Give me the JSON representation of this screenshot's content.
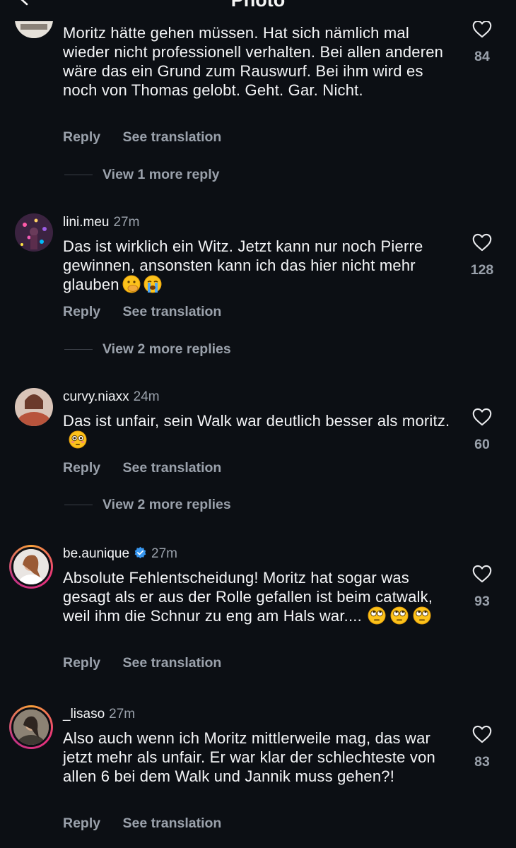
{
  "header": {
    "title": "Photo"
  },
  "comments": [
    {
      "username": "",
      "time": "",
      "text": "Moritz hätte gehen müssen. Hat sich nämlich mal wieder nicht professionell verhalten. Bei allen anderen wäre das ein Grund zum Rauswurf. Bei ihm wird es noch von Thomas gelobt. Geht. Gar. Nicht.",
      "likes": "84",
      "reply_label": "Reply",
      "translate_label": "See translation",
      "view_replies": "View 1 more reply"
    },
    {
      "username": "lini.meu",
      "time": "27m",
      "text": "Das ist wirklich ein Witz. Jetzt kann nur noch Pierre gewinnen, ansonsten kann ich das hier nicht mehr glauben",
      "emojis": [
        "face-with-hand-over-mouth-emoji",
        "loudly-crying-face-emoji"
      ],
      "likes": "128",
      "reply_label": "Reply",
      "translate_label": "See translation",
      "view_replies": "View 2 more replies"
    },
    {
      "username": "curvy.niaxx",
      "time": "24m",
      "text": "Das ist unfair, sein Walk war deutlich besser als moritz.",
      "emojis": [
        "flushed-face-emoji"
      ],
      "likes": "60",
      "reply_label": "Reply",
      "translate_label": "See translation",
      "view_replies": "View 2 more replies"
    },
    {
      "username": "be.aunique",
      "verified": true,
      "time": "27m",
      "text": "Absolute Fehlentscheidung! Moritz hat sogar was gesagt als er aus der Rolle gefallen ist beim catwalk, weil ihm die Schnur zu eng am Hals war....",
      "emojis": [
        "face-with-rolling-eyes-emoji",
        "face-with-rolling-eyes-emoji",
        "face-with-rolling-eyes-emoji"
      ],
      "likes": "93",
      "reply_label": "Reply",
      "translate_label": "See translation"
    },
    {
      "username": "_lisaso",
      "time": "27m",
      "text": "Also auch wenn ich Moritz mittlerweile mag, das war jetzt mehr als unfair. Er war klar der schlechteste von allen 6 bei dem Walk und Jannik muss gehen?!",
      "likes": "83",
      "reply_label": "Reply",
      "translate_label": "See translation"
    }
  ],
  "colors": {
    "background": "#0c0f14",
    "text_primary": "#f4f5f7",
    "text_secondary": "#9aa1ab",
    "verified": "#3897f0",
    "story_ring_start": "#f9a13a",
    "story_ring_end": "#c13584"
  }
}
